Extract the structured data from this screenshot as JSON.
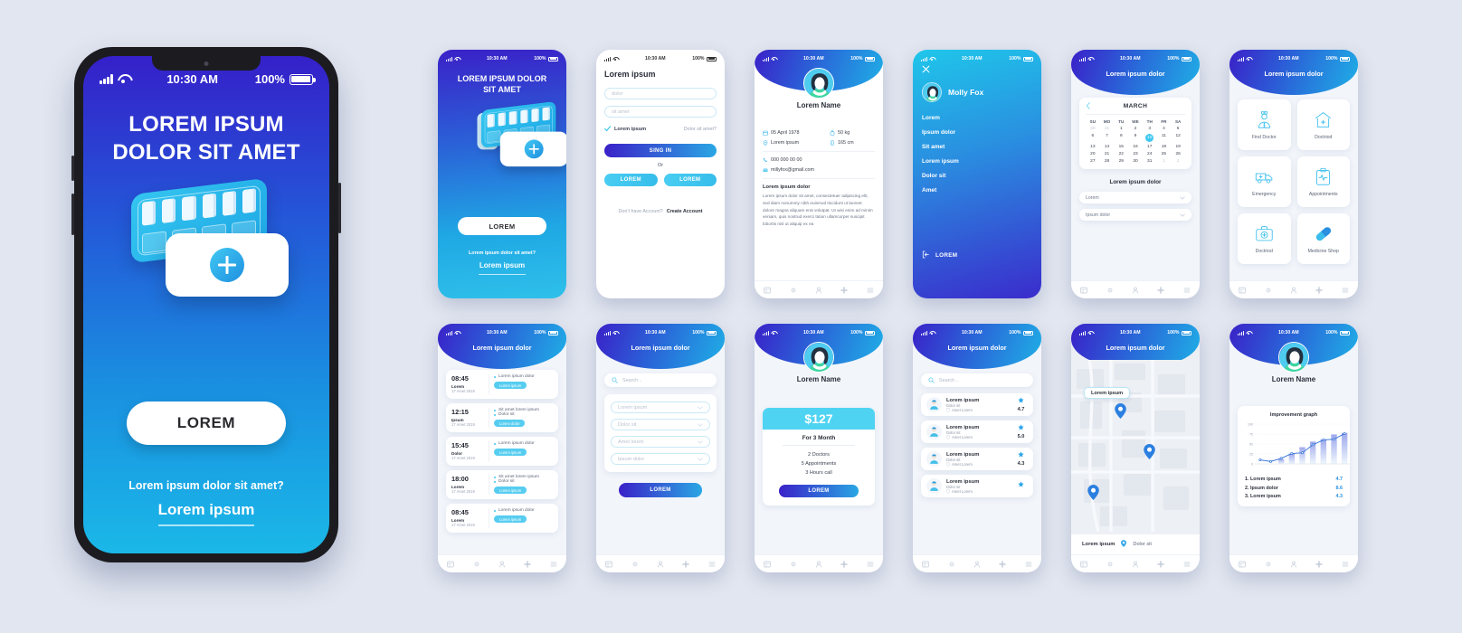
{
  "meta": {
    "bg_color": "#e2e6f0",
    "accent_blue": "#2a63d8",
    "accent_cyan": "#2ab8e8",
    "purple": "#3a21c8"
  },
  "status_bar": {
    "time": "10:30 AM",
    "battery": "100%"
  },
  "big_phone": {
    "title": "LOREM IPSUM DOLOR SIT AMET",
    "button": "LOREM",
    "sub_text": "Lorem ipsum dolor sit amet?",
    "link_text": "Lorem ipsum"
  },
  "screens": [
    {
      "id": "splash",
      "title": "LOREM IPSUM DOLOR SIT AMET",
      "button": "LOREM",
      "sub_text": "Lorem ipsum dolor sit amet?",
      "link_text": "Lorem ipsum"
    },
    {
      "id": "signin",
      "title": "Lorem ipsum",
      "field1_placeholder": "dolor",
      "field2_placeholder": "sit amet",
      "checkbox_label": "Lorem  ipsum",
      "forgot_label": "Dolor sit amet?",
      "primary_button": "SING IN",
      "or_label": "Or",
      "social1": "LOREM",
      "social2": "LOREM",
      "footer_question": "Don't have Account?",
      "footer_action": "Create Account"
    },
    {
      "id": "profile",
      "name": "Lorem Name",
      "birthday": "05 April 1978",
      "weight": "50 kg",
      "location": "Lorem ipsum",
      "height": "165 cm",
      "phone": "000 000 00 00",
      "email": "millyfox@gmail.com",
      "about_title": "Lorem ipsum dolor",
      "about_body": "Lorem ipsum dolor sit amet, consectetuer adipiscing elit, sed diam nonummy nibh euismod tincidunt ut laoreet dolore magna aliquam erat volutpat. Ut wisi enim ad minim veniam, quis nostrud exerci tation ullamcorper suscipit lobortis nisl ut aliquip ex ea"
    },
    {
      "id": "menu",
      "user_name": "Molly Fox",
      "items": [
        "Lorem",
        "Ipsum dolor",
        "Sit amet",
        "Lorem ipsum",
        "Dolor sit",
        "Amet"
      ],
      "logout_label": "LOREM",
      "close_icon": "close-icon"
    },
    {
      "id": "calendar",
      "title": "Lorem ipsum dolor",
      "month": "MARCH",
      "weekdays": [
        "SU",
        "MO",
        "TU",
        "WE",
        "TH",
        "FR",
        "SA"
      ],
      "weeks": [
        [
          {
            "d": "30",
            "mute": true
          },
          {
            "d": "31",
            "mute": true
          },
          {
            "d": "1"
          },
          {
            "d": "2"
          },
          {
            "d": "3"
          },
          {
            "d": "4"
          },
          {
            "d": "5"
          }
        ],
        [
          {
            "d": "6"
          },
          {
            "d": "7"
          },
          {
            "d": "8"
          },
          {
            "d": "9"
          },
          {
            "d": "10",
            "sel": true
          },
          {
            "d": "11"
          },
          {
            "d": "12"
          }
        ],
        [
          {
            "d": "13"
          },
          {
            "d": "14"
          },
          {
            "d": "15"
          },
          {
            "d": "16"
          },
          {
            "d": "17"
          },
          {
            "d": "18"
          },
          {
            "d": "19"
          }
        ],
        [
          {
            "d": "20"
          },
          {
            "d": "21"
          },
          {
            "d": "22"
          },
          {
            "d": "23"
          },
          {
            "d": "24"
          },
          {
            "d": "25"
          },
          {
            "d": "26"
          }
        ],
        [
          {
            "d": "27"
          },
          {
            "d": "28"
          },
          {
            "d": "29"
          },
          {
            "d": "30"
          },
          {
            "d": "31"
          },
          {
            "d": "1",
            "mute": true
          },
          {
            "d": "2",
            "mute": true
          }
        ]
      ],
      "section_title": "Lorem ipsum dolor",
      "select1": "Lorem",
      "select2": "Ipsum dolor"
    },
    {
      "id": "services",
      "title": "Lorem ipsum dolor",
      "tiles": [
        {
          "label": "Find Doctor",
          "icon": "doctor-icon"
        },
        {
          "label": "Doctriod",
          "icon": "hospital-home-icon"
        },
        {
          "label": "Emergency",
          "icon": "ambulance-icon"
        },
        {
          "label": "Appointments",
          "icon": "clipboard-pulse-icon"
        },
        {
          "label": "Doctriod",
          "icon": "first-aid-kit-icon"
        },
        {
          "label": "Medicine Shop",
          "icon": "pill-capsule-icon"
        }
      ]
    },
    {
      "id": "schedule",
      "title": "Lorem ipsum dolor",
      "entries": [
        {
          "time": "08:45",
          "name": "Lorem",
          "date": "17 Amet 2019",
          "lines": [
            "Lorem ipsum dolor"
          ],
          "tag": "Lorem ipsum"
        },
        {
          "time": "12:15",
          "name": "Ipsum",
          "date": "17 Amet 2019",
          "lines": [
            "Sit amet lorem ipsum",
            "Dolor sit"
          ],
          "tag": "Lorem dolor"
        },
        {
          "time": "15:45",
          "name": "Dolor",
          "date": "17 Amet 2019",
          "lines": [
            "Lorem ipsum dolor"
          ],
          "tag": "Lorem ipsum"
        },
        {
          "time": "18:00",
          "name": "Lorem",
          "date": "17 Amet 2019",
          "lines": [
            "Sit amet lorem ipsum",
            "Dolor sit"
          ],
          "tag": "Lorem ipsum"
        },
        {
          "time": "08:45",
          "name": "Lorem",
          "date": "17 Amet 2019",
          "lines": [
            "Lorem ipsum dolor"
          ],
          "tag": "Lorem ipsum"
        }
      ]
    },
    {
      "id": "filters",
      "title": "Lorem ipsum dolor",
      "search_placeholder": "Search ..",
      "selects": [
        "Lorem ipsum",
        "Dolor sit",
        "Amet lorem",
        "Ipsum dolor"
      ],
      "button": "LOREM"
    },
    {
      "id": "pricing",
      "name": "Lorem Name",
      "price": "$127",
      "period": "For 3 Month",
      "features": [
        "2 Doctors",
        "5 Appointments",
        "3 Hours call"
      ],
      "button": "LOREM"
    },
    {
      "id": "doctor-list",
      "title": "Lorem ipsum dolor",
      "search_placeholder": "Search ..",
      "items": [
        {
          "name": "Lorem ipsum",
          "role": "Dolor sit",
          "place": "Amet Lorem",
          "rating": "4.7"
        },
        {
          "name": "Lorem ipsum",
          "role": "Dolor sit",
          "place": "Amet Lorem",
          "rating": "5.0"
        },
        {
          "name": "Lorem ipsum",
          "role": "Dolor sit",
          "place": "Amet Lorem",
          "rating": "4.3"
        },
        {
          "name": "Lorem ipsum",
          "role": "Dolor sit",
          "place": "Amet Lorem",
          "rating": ""
        }
      ]
    },
    {
      "id": "map",
      "title": "Lorem ipsum dolor",
      "tooltip": "Lorem ipsum",
      "footer_left": "Lorem ipsum",
      "footer_right": "Dolor sit",
      "pins": 3
    },
    {
      "id": "graph",
      "name": "Lorem Name",
      "chart_title": "Improvement graph",
      "legend": [
        {
          "label": "1. Lorem ipsum",
          "value": "4.7"
        },
        {
          "label": "2. Ipsum dolor",
          "value": "8.6"
        },
        {
          "label": "3. Lorem ipsum",
          "value": "4.3"
        }
      ]
    }
  ],
  "chart_data": {
    "type": "line",
    "title": "Improvement graph",
    "xlabel": "",
    "ylabel": "",
    "ylim": [
      0,
      100
    ],
    "yticks": [
      0,
      25,
      50,
      75,
      100
    ],
    "grid": true,
    "legend_position": "below",
    "categories": [
      "1",
      "2",
      "3",
      "4",
      "5",
      "6",
      "7",
      "8",
      "9"
    ],
    "series": [
      {
        "name": "line",
        "type": "line",
        "values": [
          10,
          6,
          14,
          26,
          28,
          48,
          60,
          62,
          76
        ]
      },
      {
        "name": "bars",
        "type": "bar",
        "values": [
          0,
          0,
          12,
          26,
          42,
          56,
          62,
          74,
          78
        ]
      }
    ],
    "annotations": [
      "1. Lorem ipsum 4.7",
      "2. Ipsum dolor 8.6",
      "3. Lorem ipsum 4.3"
    ]
  }
}
